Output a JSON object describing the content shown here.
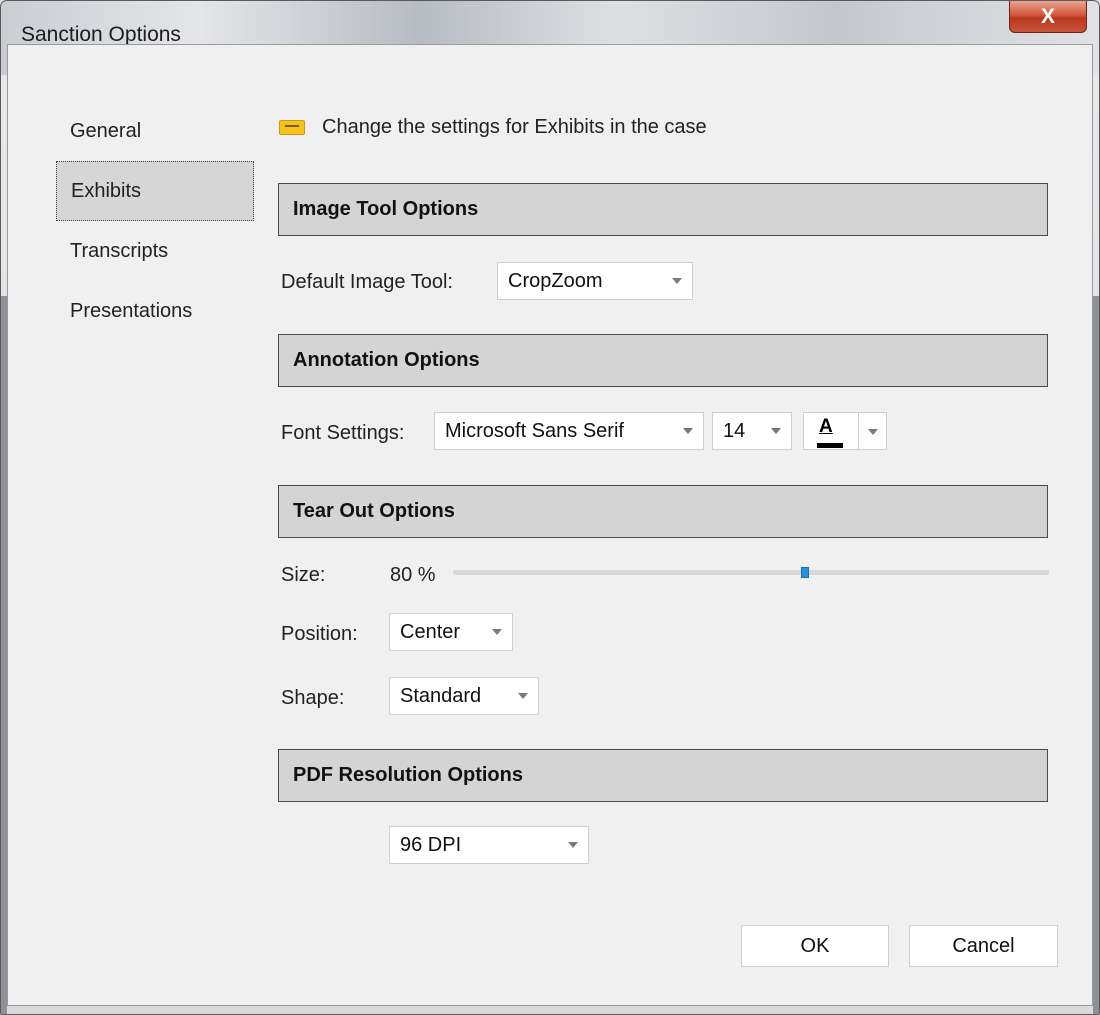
{
  "window": {
    "title": "Sanction Options",
    "close_glyph": "X"
  },
  "nav": {
    "items": [
      {
        "label": "General"
      },
      {
        "label": "Exhibits",
        "selected": true
      },
      {
        "label": "Transcripts"
      },
      {
        "label": "Presentations"
      }
    ]
  },
  "header": {
    "icon": "exhibit-sticker-icon",
    "text": "Change the settings for Exhibits in the case"
  },
  "image_tool": {
    "section_title": "Image Tool Options",
    "default_label": "Default Image Tool:",
    "default_value": "CropZoom"
  },
  "annotation": {
    "section_title": "Annotation Options",
    "font_label": "Font Settings:",
    "font_family": "Microsoft Sans Serif",
    "font_size": "14",
    "color_glyph": "A",
    "color_value": "#000000"
  },
  "tear_out": {
    "section_title": "Tear Out Options",
    "size_label": "Size:",
    "size_value": "80 %",
    "size_slider_fraction": 0.59,
    "position_label": "Position:",
    "position_value": "Center",
    "shape_label": "Shape:",
    "shape_value": "Standard"
  },
  "pdf": {
    "section_title": "PDF Resolution Options",
    "resolution_value": "96 DPI"
  },
  "buttons": {
    "ok": "OK",
    "cancel": "Cancel"
  },
  "colors": {
    "accent": "#2a8fd9",
    "section_bg": "#d4d4d4",
    "icon_yellow": "#f5c11c"
  }
}
